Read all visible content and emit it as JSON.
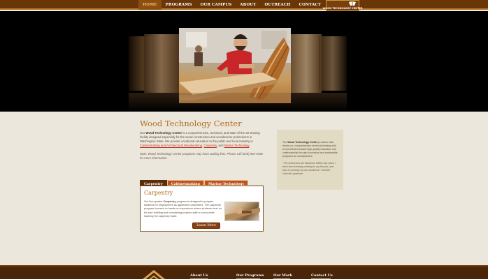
{
  "nav": {
    "items": [
      {
        "label": "HOME",
        "active": true
      },
      {
        "label": "PROGRAMS",
        "active": false
      },
      {
        "label": "OUR CAMPUS",
        "active": false
      },
      {
        "label": "ABOUT",
        "active": false
      },
      {
        "label": "OUTREACH",
        "active": false
      },
      {
        "label": "CONTACT",
        "active": false
      }
    ],
    "logo_text": "WOOD TECHNOLOGY CENTER"
  },
  "main": {
    "title": "Wood Technology Center",
    "intro_pre": "Our ",
    "intro_bold": "Wood Technology Center",
    "intro_mid": " is a comprehensive, technical, and state-of-the-art training facility designed especially for the wood construction and woodworker professions in Washington State. We provide vocational education to the public and local industry in ",
    "link_cabinet": "Cabinetmaking and Architectural Woodworking",
    "sep1": ", ",
    "link_carpentry": "Carpentry",
    "sep2": ", and ",
    "link_marine": "Marine Technology",
    "end": ".",
    "note": "Note: Wood Technology Center programs may have waiting lists. Please call (206) 934-5450 for more information."
  },
  "tabs": [
    {
      "label": "Carpentry",
      "active": true
    },
    {
      "label": "Cabinetmaking",
      "active": false
    },
    {
      "label": "Marine Technology",
      "active": false
    }
  ],
  "panel": {
    "title": "Carpentry",
    "text_pre": "Our five-quarter ",
    "text_bold": "Carpentry",
    "text_post": " program is designed to prepare students for employment as apprentice carpenters. The carpentry program focuses on hands-on experience where students work on full size building and remodeling projects (with a crew) while learning the carpentry trade.",
    "button": "Learn More"
  },
  "sidebar": {
    "text_pre": "The ",
    "text_bold": "Wood Technology Center",
    "text_post": " provides safe, hands-on, comprehensive technical training with a commitment toward high quality education and craftsmanship through innovative and sustainable programs for woodworkers.",
    "quote": "\"The instructors are fabulous! Within two years I went from knowing nothing to my first job, and now to running my own business!\" Jennifer Hammill, graduate."
  },
  "footer": {
    "cols": [
      "About Us",
      "Our Programs",
      "Our Work",
      "Contact Us"
    ]
  },
  "colors": {
    "nav_bg": "#6a3608",
    "accent": "#b06e1c",
    "tab_active": "#5a2e08",
    "tab_inactive": "#c0511a",
    "button": "#8a3f10"
  }
}
